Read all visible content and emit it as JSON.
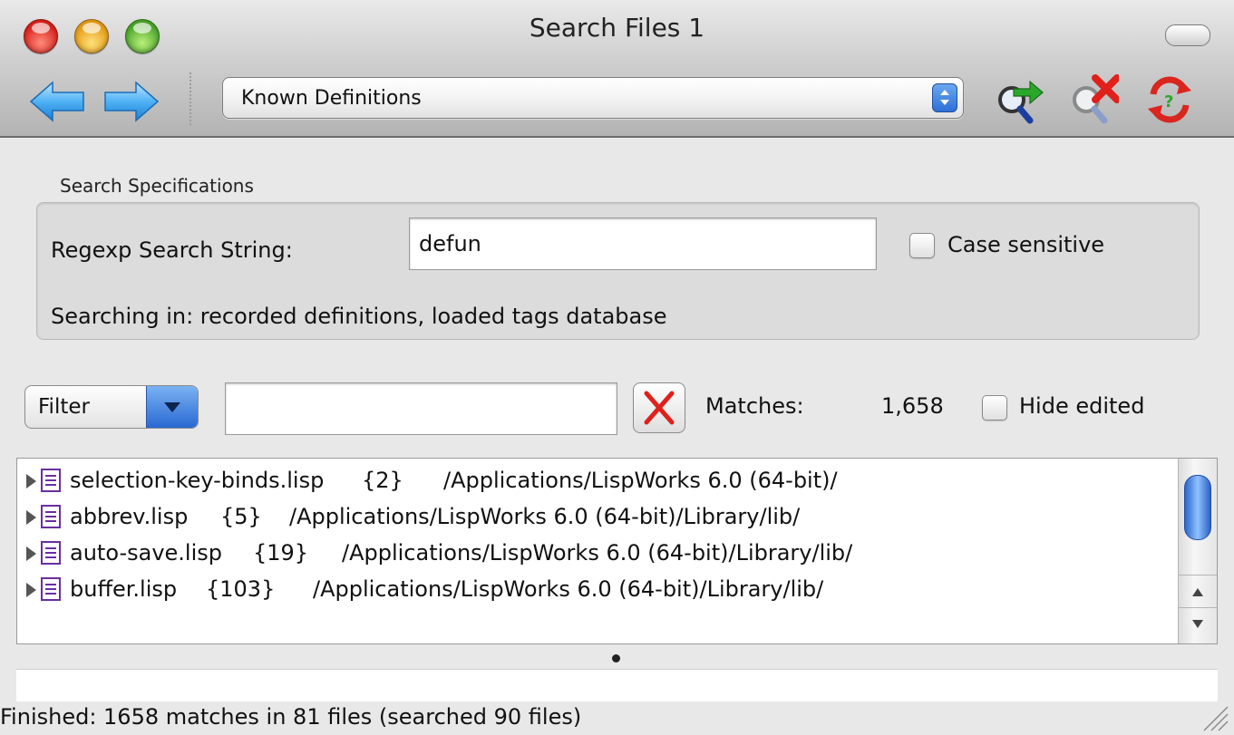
{
  "window": {
    "title": "Search Files 1"
  },
  "toolbar": {
    "back_icon": "left-arrow-icon",
    "forward_icon": "right-arrow-icon",
    "search_type": {
      "selected": "Known Definitions"
    },
    "actions": [
      {
        "name": "start-search",
        "icon": "magnifier-green-arrow-icon"
      },
      {
        "name": "stop-search",
        "icon": "magnifier-red-x-icon"
      },
      {
        "name": "reset-search",
        "icon": "red-circular-arrows-icon"
      }
    ]
  },
  "search_spec": {
    "group_label": "Search Specifications",
    "regexp_label": "Regexp Search String:",
    "regexp_value": "defun",
    "case_sensitive_label": "Case sensitive",
    "case_sensitive_checked": false,
    "searching_in": "Searching in:  recorded definitions, loaded tags database"
  },
  "filter": {
    "button_label": "Filter",
    "value": "",
    "matches_label": "Matches:",
    "matches_count": "1,658",
    "hide_edited_label": "Hide edited",
    "hide_edited_checked": false
  },
  "results": [
    {
      "name": "selection-key-binds.lisp",
      "count": "{2}",
      "path": "/Applications/LispWorks 6.0 (64-bit)/"
    },
    {
      "name": "abbrev.lisp",
      "count": "{5}",
      "path": "/Applications/LispWorks 6.0 (64-bit)/Library/lib/"
    },
    {
      "name": "auto-save.lisp",
      "count": "{19}",
      "path": "/Applications/LispWorks 6.0 (64-bit)/Library/lib/"
    },
    {
      "name": "buffer.lisp",
      "count": "{103}",
      "path": "/Applications/LispWorks 6.0 (64-bit)/Library/lib/"
    }
  ],
  "status": {
    "text": "Finished:  1658 matches in 81 files (searched 90 files)"
  },
  "colors": {
    "accent_blue": "#2d6fd6",
    "stop_red": "#e0201a",
    "go_green": "#2aa82a"
  }
}
